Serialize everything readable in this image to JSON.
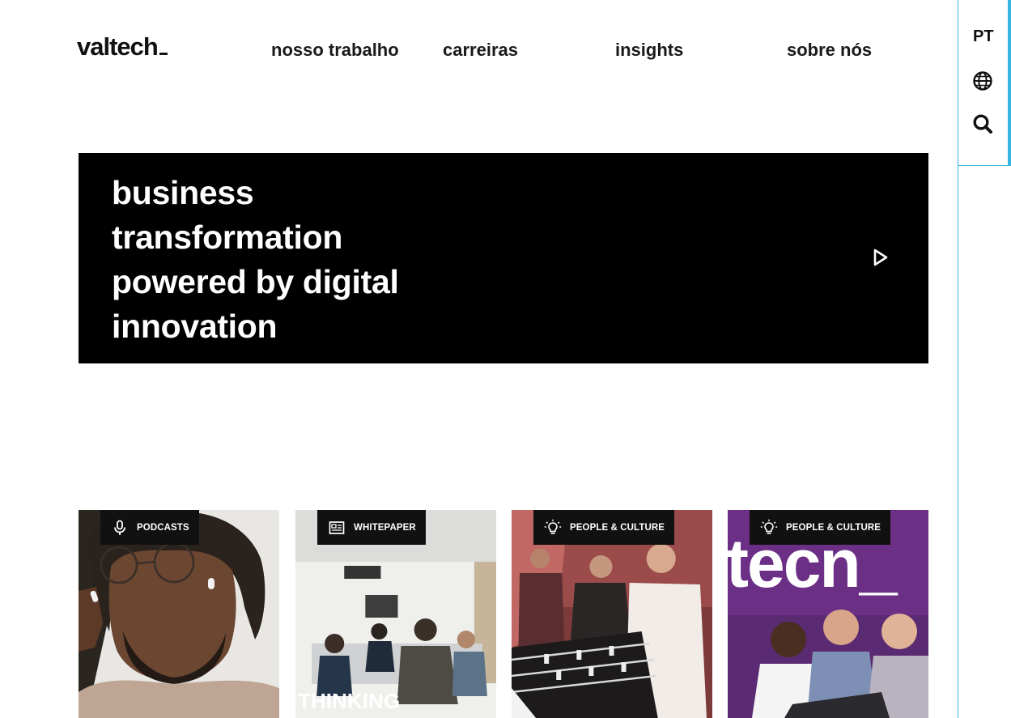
{
  "brand": {
    "logo_text": "valtech"
  },
  "nav": {
    "items": [
      {
        "label": "nosso trabalho"
      },
      {
        "label": "carreiras"
      },
      {
        "label": "insights"
      },
      {
        "label": "sobre nós"
      }
    ]
  },
  "side_rail": {
    "language": "PT",
    "icons": [
      "globe-icon",
      "search-icon"
    ],
    "accent_color": "#37b6e3"
  },
  "hero": {
    "title": "business transformation powered by digital innovation",
    "background": "#000000",
    "icon": "play-icon"
  },
  "cards": [
    {
      "category": "PODCASTS",
      "icon": "microphone-icon"
    },
    {
      "category": "WHITEPAPER",
      "icon": "document-icon",
      "image_text": "THINKING"
    },
    {
      "category": "PEOPLE & CULTURE",
      "icon": "lightbulb-icon"
    },
    {
      "category": "PEOPLE & CULTURE",
      "icon": "lightbulb-icon",
      "image_text": "tecn_"
    }
  ]
}
